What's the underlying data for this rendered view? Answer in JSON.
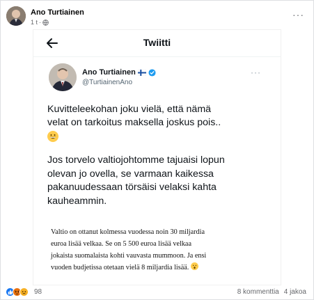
{
  "post": {
    "author": "Ano Turtiainen",
    "time": "1 t",
    "separator": "·",
    "more": "···"
  },
  "tweet": {
    "header_title": "Twiitti",
    "name": "Ano Turtiainen",
    "handle": "@TurtiainenAno",
    "more": "···",
    "paragraph1_line1": "Kuvitteleekohan joku vielä, että nämä",
    "paragraph1_line2": "velat on tarkoitus maksella joskus pois..",
    "paragraph2_line1": "Jos torvelo valtiojohtomme tajuaisi lopun",
    "paragraph2_line2": "olevan jo ovella, se varmaan kaikessa",
    "paragraph2_line3": "pakanuudessaan törsäisi velaksi kahta",
    "paragraph2_line4": "kauheammin.",
    "icons": {
      "back": "arrow-left-icon",
      "flag": "finland-flag-icon",
      "verified": "verified-badge-icon",
      "emoji": "grinning-emoji-icon"
    }
  },
  "quote": {
    "line1": "Valtio on ottanut kolmessa vuodessa noin 30 miljardia",
    "line2": "euroa lisää velkaa. Se on 5 500 euroa lisää velkaa",
    "line3": "jokaista suomalaista kohti vauvasta mummoon. Ja ensi",
    "line4": "vuoden budjetissa otetaan vielä 8 miljardia lisää."
  },
  "footer": {
    "reaction_count": "98",
    "comments": "8 kommenttia",
    "shares": "4 jakoa",
    "reaction_colors": {
      "like": "#1877f2",
      "angry": "#e9710f",
      "sad": "#f7b125"
    }
  }
}
